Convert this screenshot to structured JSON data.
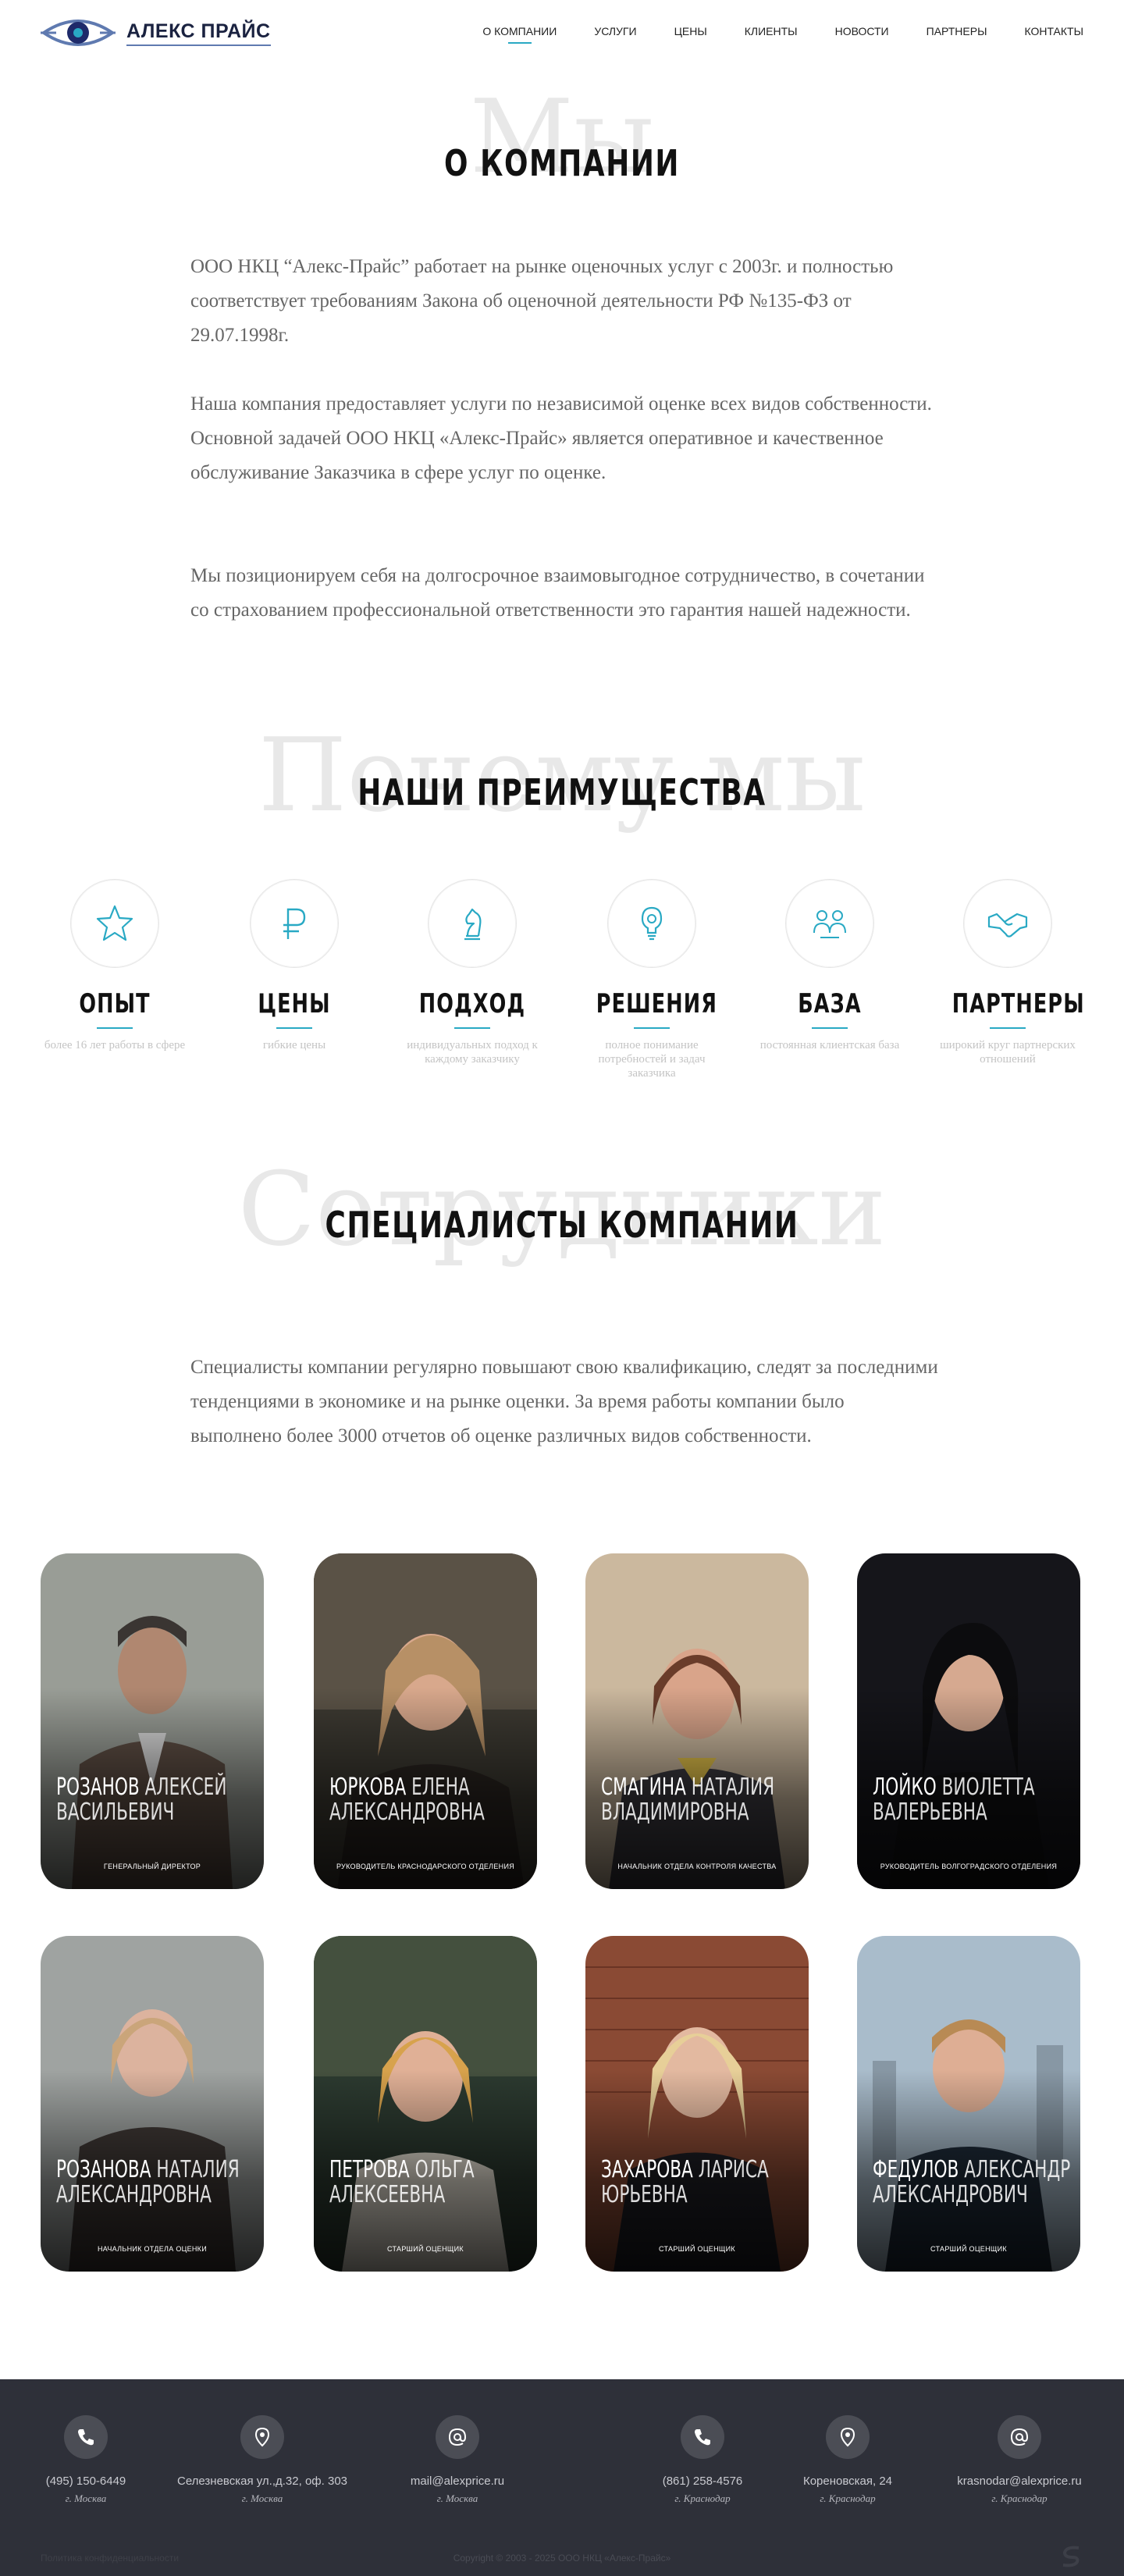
{
  "header": {
    "logo_text": "АЛЕКС ПРАЙС",
    "nav": [
      "О КОМПАНИИ",
      "УСЛУГИ",
      "ЦЕНЫ",
      "КЛИЕНТЫ",
      "НОВОСТИ",
      "ПАРТНЕРЫ",
      "КОНТАКТЫ"
    ],
    "active_nav": "О КОМПАНИИ"
  },
  "about": {
    "bg_word": "Мы",
    "title": "О КОМПАНИИ",
    "paragraphs": [
      "ООО НКЦ “Алекс-Прайс” работает на рынке оценочных услуг с 2003г. и полностью соответствует требованиям Закона об оценочной деятельности РФ №135-ФЗ от 29.07.1998г.",
      "Наша компания предоставляет услуги по независимой оценке всех видов собственности. Основной задачей ООО НКЦ «Алекс-Прайс» является оперативное и качественное обслуживание Заказчика в сфере услуг по оценке.",
      "Мы позиционируем себя на долгосрочное взаимовыгодное сотрудничество, в сочетании со страхованием профессиональной ответственности это гарантия нашей надежности."
    ]
  },
  "advantages": {
    "bg_word": "Почему мы",
    "title": "НАШИ ПРЕИМУЩЕСТВА",
    "items": [
      {
        "icon": "star-icon",
        "title": "ОПЫТ",
        "text": "более 16 лет работы в сфере"
      },
      {
        "icon": "ruble-icon",
        "title": "ЦЕНЫ",
        "text": "гибкие цены"
      },
      {
        "icon": "chess-knight-icon",
        "title": "ПОДХОД",
        "text": "индивидуальных подход к каждому заказчику"
      },
      {
        "icon": "lightbulb-gear-icon",
        "title": "РЕШЕНИЯ",
        "text": "полное понимание потребностей и задач заказчика"
      },
      {
        "icon": "clients-icon",
        "title": "БАЗА",
        "text": "постоянная клиентская база"
      },
      {
        "icon": "handshake-icon",
        "title": "ПАРТНЕРЫ",
        "text": "широкий круг партнерских отношений"
      }
    ]
  },
  "team": {
    "bg_word": "Сотрудники",
    "title": "СПЕЦИАЛИСТЫ КОМПАНИИ",
    "intro": "Специалисты компании регулярно повышают свою квалификацию, следят за последними тенденциями в экономике и на рынке оценки. За время работы компании было выполнено более 3000 отчетов об оценке различных видов собственности.",
    "members": [
      {
        "last": "РОЗАНОВ",
        "first": "АЛЕКСЕЙ",
        "middle": "ВАСИЛЬЕВИЧ",
        "role": "ГЕНЕРАЛЬНЫЙ ДИРЕКТОР"
      },
      {
        "last": "ЮРКОВА",
        "first": "ЕЛЕНА",
        "middle": "АЛЕКСАНДРОВНА",
        "role": "РУКОВОДИТЕЛЬ КРАСНОДАРСКОГО ОТДЕЛЕНИЯ"
      },
      {
        "last": "СМАГИНА",
        "first": "НАТАЛИЯ",
        "middle": "ВЛАДИМИРОВНА",
        "role": "НАЧАЛЬНИК ОТДЕЛА КОНТРОЛЯ КАЧЕСТВА"
      },
      {
        "last": "ЛОЙКО",
        "first": "ВИОЛЕТТА",
        "middle": "ВАЛЕРЬЕВНА",
        "role": "РУКОВОДИТЕЛЬ ВОЛГОГРАДСКОГО ОТДЕЛЕНИЯ"
      },
      {
        "last": "РОЗАНОВА",
        "first": "НАТАЛИЯ",
        "middle": "АЛЕКСАНДРОВНА",
        "role": "НАЧАЛЬНИК ОТДЕЛА ОЦЕНКИ"
      },
      {
        "last": "ПЕТРОВА",
        "first": "ОЛЬГА",
        "middle": "АЛЕКСЕЕВНА",
        "role": "СТАРШИЙ ОЦЕНЩИК"
      },
      {
        "last": "ЗАХАРОВА",
        "first": "ЛАРИСА",
        "middle": "ЮРЬЕВНА",
        "role": "СТАРШИЙ ОЦЕНЩИК"
      },
      {
        "last": "ФЕДУЛОВ",
        "first": "АЛЕКСАНДР",
        "middle": "АЛЕКСАНДРОВИЧ",
        "role": "СТАРШИЙ ОЦЕНЩИК"
      }
    ]
  },
  "footer": {
    "contacts": [
      {
        "icon": "phone-icon",
        "text": "(495) 150-6449",
        "city": "г. Москва"
      },
      {
        "icon": "location-icon",
        "text": "Селезневская ул.,д.32, оф. 303",
        "city": "г. Москва"
      },
      {
        "icon": "at-icon",
        "text": "mail@alexprice.ru",
        "city": "г. Москва"
      },
      {
        "icon": "phone-icon",
        "text": "(861) 258-4576",
        "city": "г. Краснодар"
      },
      {
        "icon": "location-icon",
        "text": "Кореновская, 24",
        "city": "г. Краснодар"
      },
      {
        "icon": "at-icon",
        "text": "krasnodar@alexprice.ru",
        "city": "г. Краснодар"
      }
    ],
    "copyright": "Copyright © 2003 - 2025 ООО НКЦ «Алекс-Прайс»",
    "left_note": "Политика конфиденциальности"
  }
}
